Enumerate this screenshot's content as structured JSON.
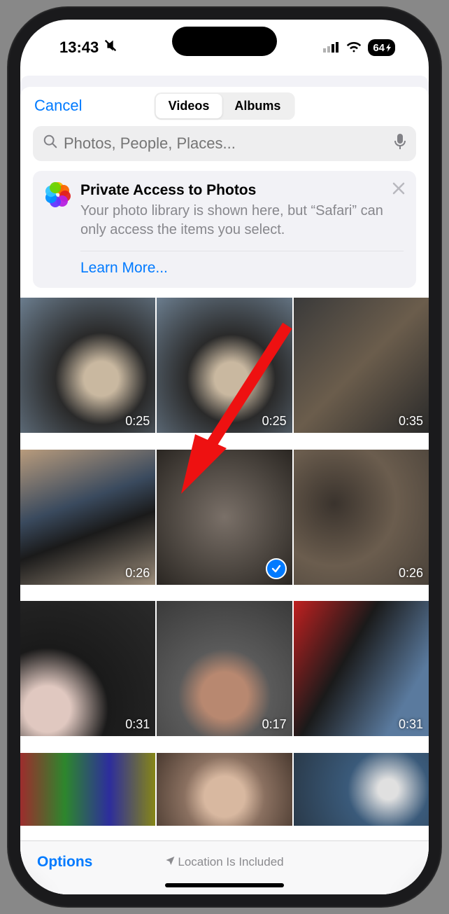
{
  "status_bar": {
    "time": "13:43",
    "battery_pct": "64"
  },
  "header": {
    "cancel_label": "Cancel",
    "tabs": {
      "videos": "Videos",
      "albums": "Albums"
    }
  },
  "search": {
    "placeholder": "Photos, People, Places..."
  },
  "privacy_card": {
    "title": "Private Access to Photos",
    "body": "Your photo library is shown here, but “Safari” can only access the items you select.",
    "learn_more": "Learn More..."
  },
  "grid_items": [
    {
      "duration": "0:25",
      "selected": false
    },
    {
      "duration": "0:25",
      "selected": false
    },
    {
      "duration": "0:35",
      "selected": false
    },
    {
      "duration": "0:26",
      "selected": false
    },
    {
      "duration": "",
      "selected": true
    },
    {
      "duration": "0:26",
      "selected": false
    },
    {
      "duration": "0:31",
      "selected": false
    },
    {
      "duration": "0:17",
      "selected": false
    },
    {
      "duration": "0:31",
      "selected": false
    },
    {
      "duration": "",
      "selected": false
    },
    {
      "duration": "",
      "selected": false
    },
    {
      "duration": "",
      "selected": false
    }
  ],
  "bottom_bar": {
    "options_label": "Options",
    "location_label": "Location Is Included"
  },
  "colors": {
    "accent": "#007aff"
  }
}
